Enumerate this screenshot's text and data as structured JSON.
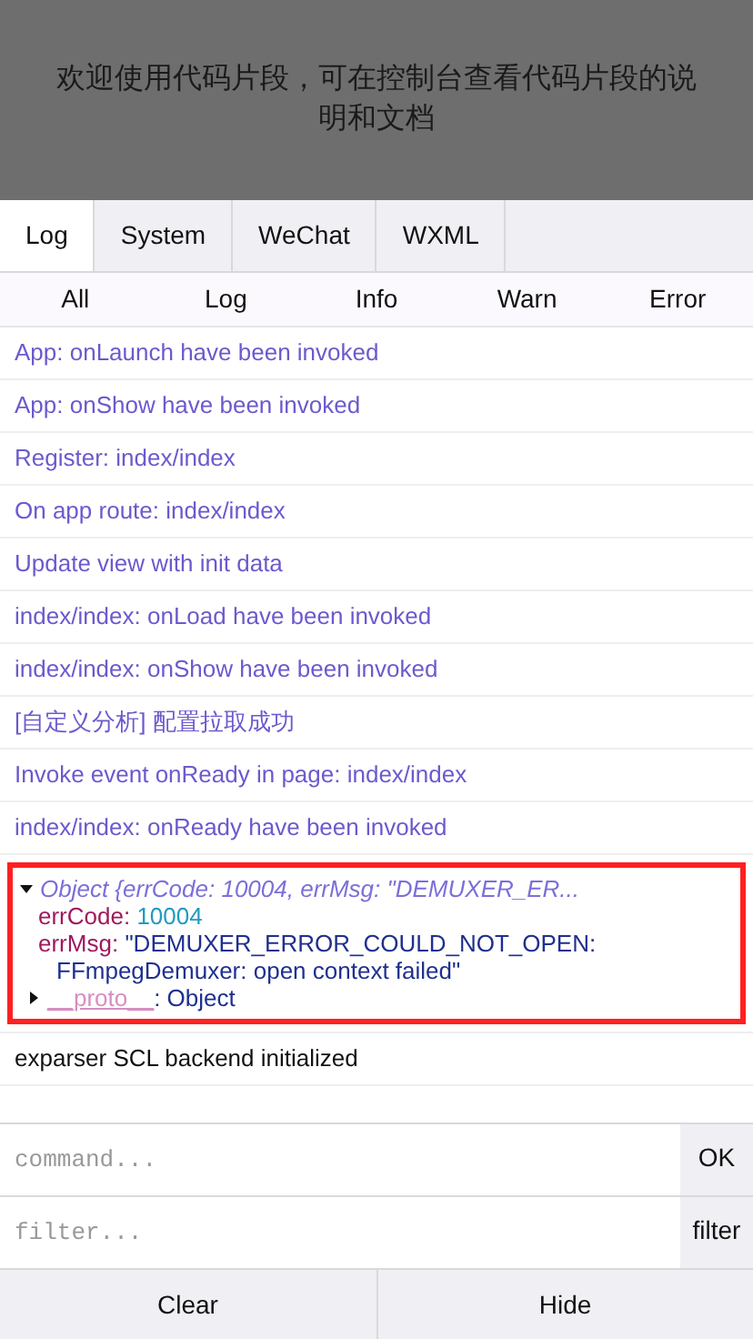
{
  "banner": {
    "text": "欢迎使用代码片段，可在控制台查看代码片段的说明和文档"
  },
  "tabs": [
    {
      "label": "Log",
      "selected": true
    },
    {
      "label": "System",
      "selected": false
    },
    {
      "label": "WeChat",
      "selected": false
    },
    {
      "label": "WXML",
      "selected": false
    }
  ],
  "filters": [
    "All",
    "Log",
    "Info",
    "Warn",
    "Error"
  ],
  "logs": [
    {
      "kind": "info",
      "text": "App: onLaunch have been invoked"
    },
    {
      "kind": "info",
      "text": "App: onShow have been invoked"
    },
    {
      "kind": "info",
      "text": "Register: index/index"
    },
    {
      "kind": "info",
      "text": "On app route: index/index"
    },
    {
      "kind": "info",
      "text": "Update view with init data"
    },
    {
      "kind": "info",
      "text": "index/index: onLoad have been invoked"
    },
    {
      "kind": "info",
      "text": "index/index: onShow have been invoked"
    },
    {
      "kind": "info",
      "text": "[自定义分析] 配置拉取成功"
    },
    {
      "kind": "info",
      "text": "Invoke event onReady in page: index/index"
    },
    {
      "kind": "info",
      "text": "index/index: onReady have been invoked"
    },
    {
      "kind": "object",
      "highlighted": true,
      "expanded": true,
      "summary": "Object {errCode: 10004, errMsg: \"DEMUXER_ER...",
      "props": [
        {
          "key": "errCode:",
          "value": "10004",
          "color": "#1f9bbf"
        },
        {
          "key": "errMsg:",
          "value": "\"DEMUXER_ERROR_COULD_NOT_OPEN: FFmpegDemuxer: open context failed\"",
          "color": "#1f2f8f"
        }
      ],
      "proto": {
        "key": "__proto__",
        "value": ": Object",
        "expanded": false
      }
    },
    {
      "kind": "log",
      "text": "exparser SCL backend initialized"
    }
  ],
  "command": {
    "placeholder": "command...",
    "button": "OK"
  },
  "filter": {
    "placeholder": "filter...",
    "button": "filter"
  },
  "footer": [
    "Clear",
    "Hide"
  ]
}
